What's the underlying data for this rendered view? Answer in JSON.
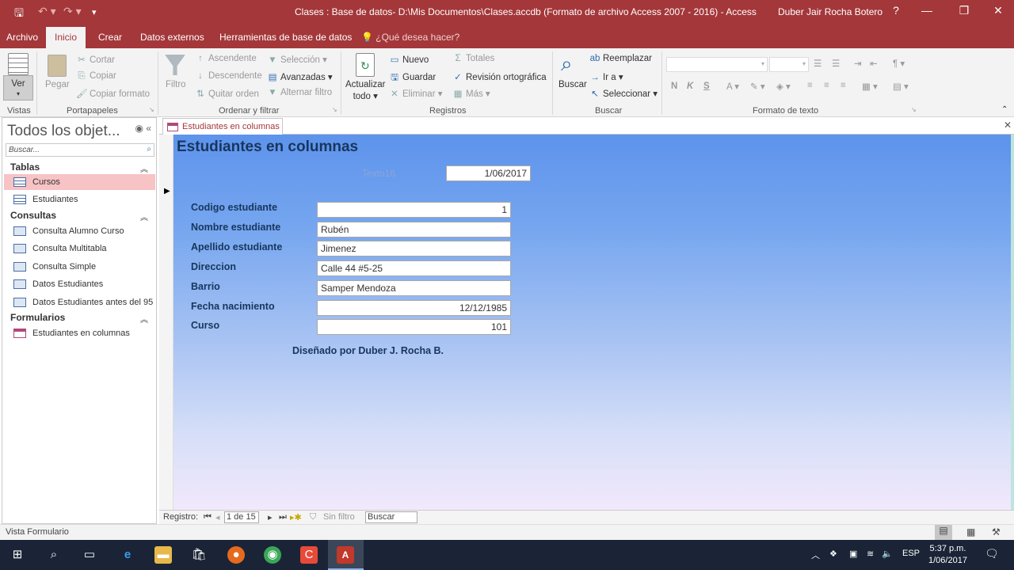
{
  "window": {
    "title": "Clases : Base de datos- D:\\Mis Documentos\\Clases.accdb (Formato de archivo Access 2007 - 2016)  -  Access",
    "user": "Duber Jair Rocha Botero",
    "help": "?",
    "qa_save": "🖫",
    "qa_undo": "↶ ▾",
    "qa_redo": "↷ ▾",
    "qa_more": "▾",
    "minimize": "—",
    "restore": "❐",
    "close": "✕"
  },
  "tabs": [
    "Archivo",
    "Inicio",
    "Crear",
    "Datos externos",
    "Herramientas de base de datos"
  ],
  "tell_me": "¿Qué desea hacer?",
  "ribbon": {
    "vistas": {
      "ver": "Ver",
      "label": "Vistas"
    },
    "portapapeles": {
      "pegar": "Pegar",
      "cortar": "Cortar",
      "copiar": "Copiar",
      "copiar_formato": "Copiar formato",
      "label": "Portapapeles"
    },
    "ordenar": {
      "filtro": "Filtro",
      "ascendente": "Ascendente",
      "descendente": "Descendente",
      "quitar_orden": "Quitar orden",
      "seleccion": "Selección",
      "avanzadas": "Avanzadas",
      "alternar_filtro": "Alternar filtro",
      "label": "Ordenar y filtrar"
    },
    "registros": {
      "actualizar": "Actualizar",
      "todo": "todo",
      "nuevo": "Nuevo",
      "guardar": "Guardar",
      "eliminar": "Eliminar",
      "totales": "Totales",
      "revision": "Revisión ortográfica",
      "mas": "Más",
      "label": "Registros"
    },
    "buscar": {
      "buscar": "Buscar",
      "reemplazar": "Reemplazar",
      "ir_a": "Ir a",
      "seleccionar": "Seleccionar",
      "label": "Buscar"
    },
    "formato": {
      "bold": "N",
      "italic": "K",
      "underline": "S",
      "label": "Formato de texto"
    }
  },
  "nav": {
    "title": "Todos los objet...",
    "search_placeholder": "Buscar...",
    "sections": [
      {
        "label": "Tablas",
        "items": [
          "Cursos",
          "Estudiantes"
        ]
      },
      {
        "label": "Consultas",
        "items": [
          "Consulta Alumno Curso",
          "Consulta Multitabla",
          "Consulta Simple",
          "Datos Estudiantes",
          "Datos Estudiantes antes del 95"
        ]
      },
      {
        "label": "Formularios",
        "items": [
          "Estudiantes en columnas"
        ]
      }
    ],
    "selected": "Cursos"
  },
  "document": {
    "tab_label": "Estudiantes en columnas",
    "close": "✕"
  },
  "form": {
    "title": "Estudiantes en columnas",
    "texto16_label": "Texto16",
    "date_value": "1/06/2017",
    "fields": [
      {
        "label": "Codigo estudiante",
        "value": "1"
      },
      {
        "label": "Nombre estudiante",
        "value": "Rubén"
      },
      {
        "label": "Apellido estudiante",
        "value": "Jimenez"
      },
      {
        "label": "Direccion",
        "value": "Calle 44 #5-25"
      },
      {
        "label": "Barrio",
        "value": "Samper Mendoza"
      },
      {
        "label": "Fecha nacimiento",
        "value": "12/12/1985"
      },
      {
        "label": "Curso",
        "value": "101"
      }
    ],
    "designed_by": "Diseñado por Duber J. Rocha B."
  },
  "record_nav": {
    "label": "Registro:",
    "current": "1 de 15",
    "no_filter": "Sin filtro",
    "search": "Buscar"
  },
  "status": {
    "text": "Vista Formulario"
  },
  "taskbar": {
    "lang": "ESP",
    "time": "5:37 p.m.",
    "date": "1/06/2017"
  }
}
